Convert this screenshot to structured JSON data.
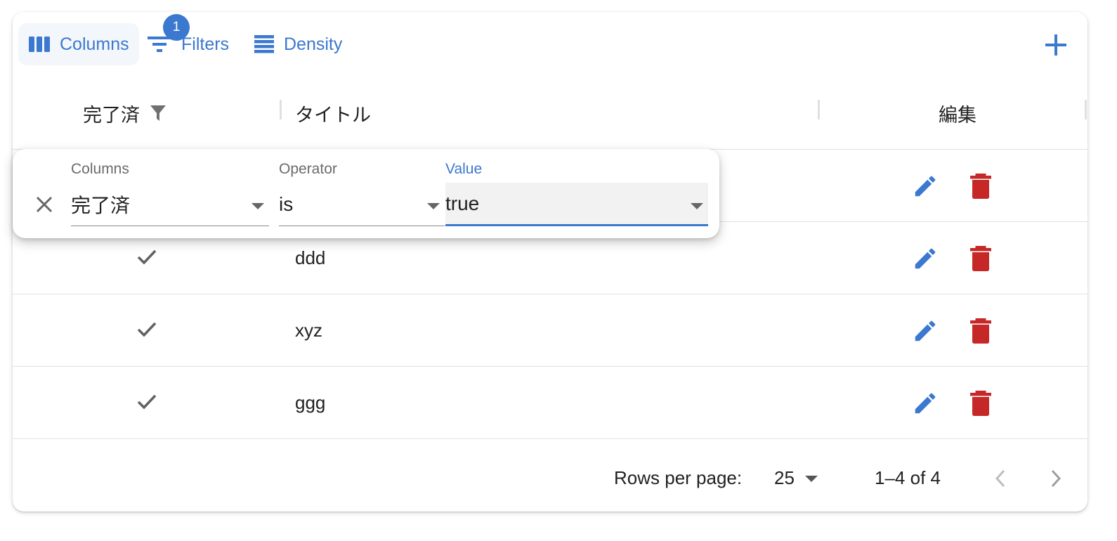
{
  "toolbar": {
    "columns_label": "Columns",
    "filters_label": "Filters",
    "filters_badge": "1",
    "density_label": "Density"
  },
  "header": {
    "done": "完了済",
    "title": "タイトル",
    "edit": "編集"
  },
  "rows": [
    {
      "done": true,
      "title": "ddd"
    },
    {
      "done": true,
      "title": "xyz"
    },
    {
      "done": true,
      "title": "ggg"
    }
  ],
  "footer": {
    "rows_per_page_label": "Rows per page:",
    "rows_per_page_value": "25",
    "range": "1–4 of 4"
  },
  "filter_panel": {
    "columns_label": "Columns",
    "columns_value": "完了済",
    "operator_label": "Operator",
    "operator_value": "is",
    "value_label": "Value",
    "value_value": "true"
  },
  "colors": {
    "accent": "#3b78d0",
    "delete": "#c62828",
    "check": "#616161"
  },
  "icons": [
    "view-column-icon",
    "filter-list-icon",
    "density-icon",
    "add-icon",
    "filter-icon",
    "check-icon",
    "pencil-icon",
    "trash-icon",
    "close-icon",
    "chevron-left-icon",
    "chevron-right-icon",
    "dropdown-arrow-icon"
  ]
}
